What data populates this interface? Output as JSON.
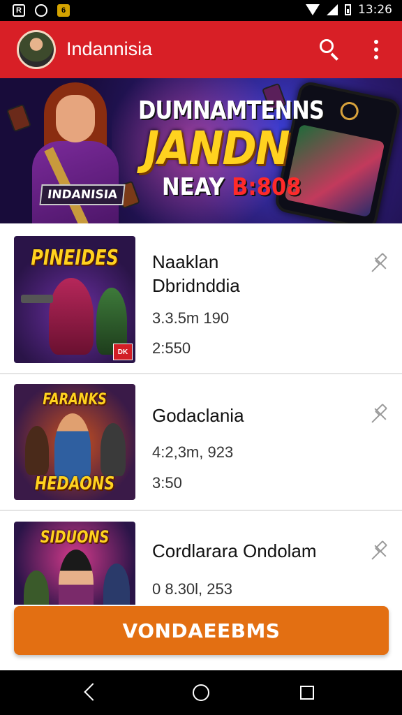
{
  "status_bar": {
    "time": "13:26",
    "left_icons": [
      "notification-icon",
      "camera-icon",
      "app-icon"
    ],
    "right_icons": [
      "wifi-icon",
      "signal-icon",
      "battery-icon"
    ]
  },
  "app_bar": {
    "title": "Indannisia",
    "actions": [
      "search-icon",
      "more-vert-icon"
    ],
    "color": "#d81f26"
  },
  "banner": {
    "tag": "INDANISIA",
    "line1": "DUMNAMTENNS",
    "line2": "JANDN",
    "line3_white": "NEAY ",
    "line3_red": "B:808"
  },
  "list": {
    "items": [
      {
        "thumb_title": "PINEIDES",
        "thumb_badge": "DK",
        "title_lines": [
          "Naaklan",
          "Dbridnddia"
        ],
        "meta1": "3.3.5m 190",
        "meta2": "2:550"
      },
      {
        "thumb_title": "FARANKS",
        "thumb_subtitle": "HEDAONS",
        "title_lines": [
          "Godaclania"
        ],
        "meta1": "4:2,3m, 923",
        "meta2": "3:50"
      },
      {
        "thumb_title": "SIDUONS",
        "title_lines": [
          "Cordlarara Ondolam"
        ],
        "meta1": "0 8.30l, 253"
      }
    ]
  },
  "cta": {
    "label": "VONDAEEBMS",
    "color": "#e36f12"
  },
  "nav_bar": {
    "buttons": [
      "back-icon",
      "home-icon",
      "recents-icon"
    ]
  }
}
